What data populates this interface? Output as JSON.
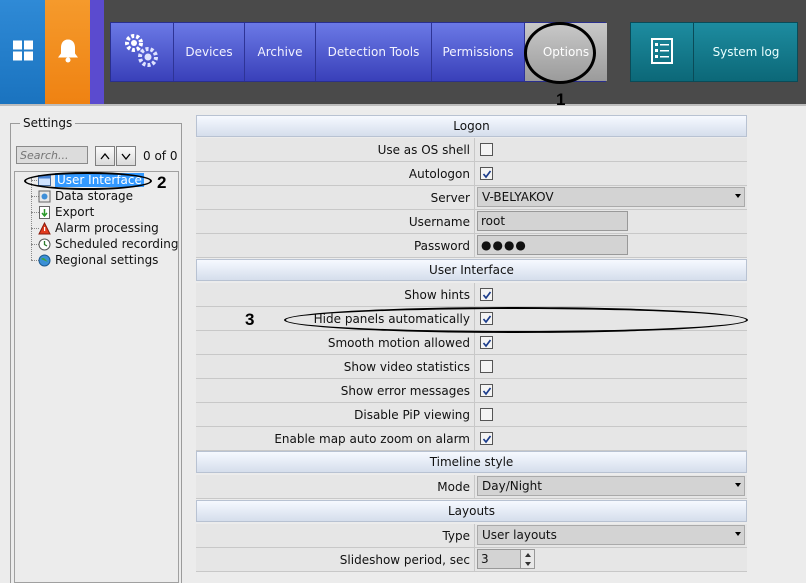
{
  "menu": {
    "items": [
      {
        "label": "Devices"
      },
      {
        "label": "Archive"
      },
      {
        "label": "Detection Tools"
      },
      {
        "label": "Permissions"
      },
      {
        "label": "Options"
      }
    ],
    "system_log": "System log"
  },
  "callouts": {
    "one": "1",
    "two": "2",
    "three": "3"
  },
  "settings": {
    "title": "Settings",
    "search_placeholder": "Search...",
    "count": "0 of 0",
    "tree": [
      {
        "label": "User Interface",
        "icon": "user-interface-icon",
        "selected": true
      },
      {
        "label": "Data storage",
        "icon": "data-storage-icon"
      },
      {
        "label": "Export",
        "icon": "export-icon"
      },
      {
        "label": "Alarm processing",
        "icon": "alarm-icon"
      },
      {
        "label": "Scheduled recording",
        "icon": "schedule-icon"
      },
      {
        "label": "Regional settings",
        "icon": "globe-icon"
      }
    ]
  },
  "sections": {
    "logon": "Logon",
    "user_interface": "User Interface",
    "timeline": "Timeline style",
    "layouts": "Layouts"
  },
  "fields": {
    "use_os_shell": {
      "label": "Use as OS shell",
      "checked": false
    },
    "autologon": {
      "label": "Autologon",
      "checked": true
    },
    "server": {
      "label": "Server",
      "value": "V-BELYAKOV"
    },
    "username": {
      "label": "Username",
      "value": "root"
    },
    "password": {
      "label": "Password",
      "value": "●●●●"
    },
    "show_hints": {
      "label": "Show hints",
      "checked": true
    },
    "hide_panels": {
      "label": "Hide panels automatically",
      "checked": true
    },
    "smooth_motion": {
      "label": "Smooth motion allowed",
      "checked": true
    },
    "video_stats": {
      "label": "Show video statistics",
      "checked": false
    },
    "error_messages": {
      "label": "Show error messages",
      "checked": true
    },
    "disable_pip": {
      "label": "Disable PiP viewing",
      "checked": false
    },
    "map_auto_zoom": {
      "label": "Enable map auto zoom on alarm",
      "checked": true
    },
    "mode": {
      "label": "Mode",
      "value": "Day/Night"
    },
    "type": {
      "label": "Type",
      "value": "User layouts"
    },
    "slideshow": {
      "label": "Slideshow period, sec",
      "value": "3"
    }
  },
  "colors": {
    "menu_blue": "#3940b9",
    "options_gray": "#9b9b9b",
    "syslog_teal": "#0c6878",
    "windows_tile": "#1a73bf",
    "alert_tile": "#ef8212",
    "selection": "#3399ff"
  }
}
